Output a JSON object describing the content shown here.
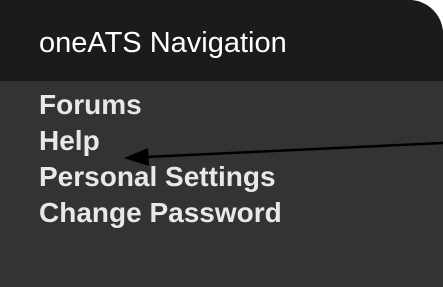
{
  "nav": {
    "title": "oneATS Navigation",
    "items": [
      {
        "label": "Forums"
      },
      {
        "label": "Help"
      },
      {
        "label": "Personal Settings"
      },
      {
        "label": "Change Password"
      }
    ]
  },
  "annotation": {
    "icon": "arrow-left-icon",
    "points_to": "Help",
    "color": "#000000"
  },
  "colors": {
    "panel_bg": "#333333",
    "header_bg": "#1b1b1b",
    "title_text": "#ffffff",
    "item_text": "#e8e8e8"
  }
}
